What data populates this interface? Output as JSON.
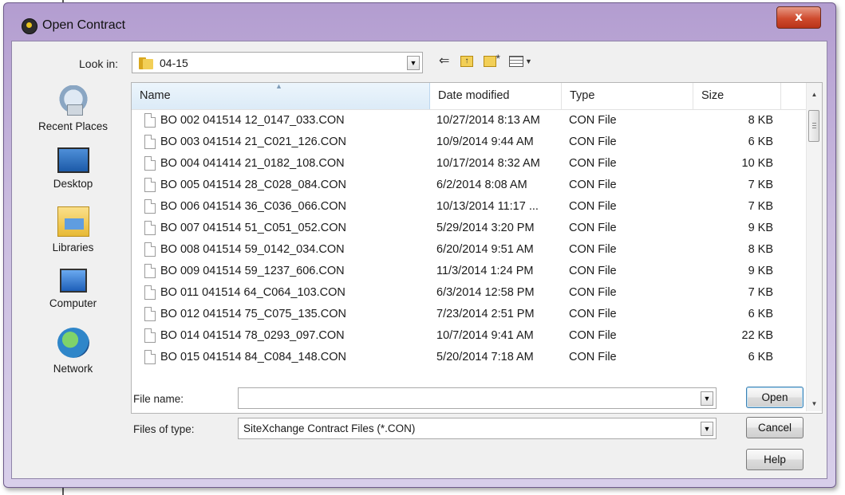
{
  "window": {
    "title": "Open Contract",
    "close_glyph": "x"
  },
  "toolbar": {
    "look_in_label": "Look in:",
    "look_in_value": "04-15",
    "icons": [
      "back-arrow-icon",
      "up-folder-icon",
      "new-folder-icon",
      "view-menu-icon"
    ]
  },
  "places": [
    {
      "label": "Recent Places",
      "icon": "recent-places-icon"
    },
    {
      "label": "Desktop",
      "icon": "desktop-icon"
    },
    {
      "label": "Libraries",
      "icon": "libraries-icon"
    },
    {
      "label": "Computer",
      "icon": "computer-icon"
    },
    {
      "label": "Network",
      "icon": "network-icon"
    }
  ],
  "columns": {
    "name": "Name",
    "date": "Date modified",
    "type": "Type",
    "size": "Size"
  },
  "files": [
    {
      "name": "BO 002 041514 12_0147_033.CON",
      "date": "10/27/2014 8:13 AM",
      "type": "CON File",
      "size": "8 KB"
    },
    {
      "name": "BO 003 041514 21_C021_126.CON",
      "date": "10/9/2014 9:44 AM",
      "type": "CON File",
      "size": "6 KB"
    },
    {
      "name": "BO 004 041414 21_0182_108.CON",
      "date": "10/17/2014 8:32 AM",
      "type": "CON File",
      "size": "10 KB"
    },
    {
      "name": "BO 005 041514 28_C028_084.CON",
      "date": "6/2/2014 8:08 AM",
      "type": "CON File",
      "size": "7 KB"
    },
    {
      "name": "BO 006 041514 36_C036_066.CON",
      "date": "10/13/2014 11:17 ...",
      "type": "CON File",
      "size": "7 KB"
    },
    {
      "name": "BO 007 041514 51_C051_052.CON",
      "date": "5/29/2014 3:20 PM",
      "type": "CON File",
      "size": "9 KB"
    },
    {
      "name": "BO 008 041514 59_0142_034.CON",
      "date": "6/20/2014 9:51 AM",
      "type": "CON File",
      "size": "8 KB"
    },
    {
      "name": "BO 009 041514 59_1237_606.CON",
      "date": "11/3/2014 1:24 PM",
      "type": "CON File",
      "size": "9 KB"
    },
    {
      "name": "BO 011 041514 64_C064_103.CON",
      "date": "6/3/2014 12:58 PM",
      "type": "CON File",
      "size": "7 KB"
    },
    {
      "name": "BO 012 041514 75_C075_135.CON",
      "date": "7/23/2014 2:51 PM",
      "type": "CON File",
      "size": "6 KB"
    },
    {
      "name": "BO 014 041514 78_0293_097.CON",
      "date": "10/7/2014 9:41 AM",
      "type": "CON File",
      "size": "22 KB"
    },
    {
      "name": "BO 015 041514 84_C084_148.CON",
      "date": "5/20/2014 7:18 AM",
      "type": "CON File",
      "size": "6 KB"
    }
  ],
  "form": {
    "file_name_label": "File name:",
    "file_name_value": "",
    "files_of_type_label": "Files of type:",
    "files_of_type_value": "SiteXchange Contract Files (*.CON)"
  },
  "buttons": {
    "open": "Open",
    "cancel": "Cancel",
    "help": "Help"
  }
}
